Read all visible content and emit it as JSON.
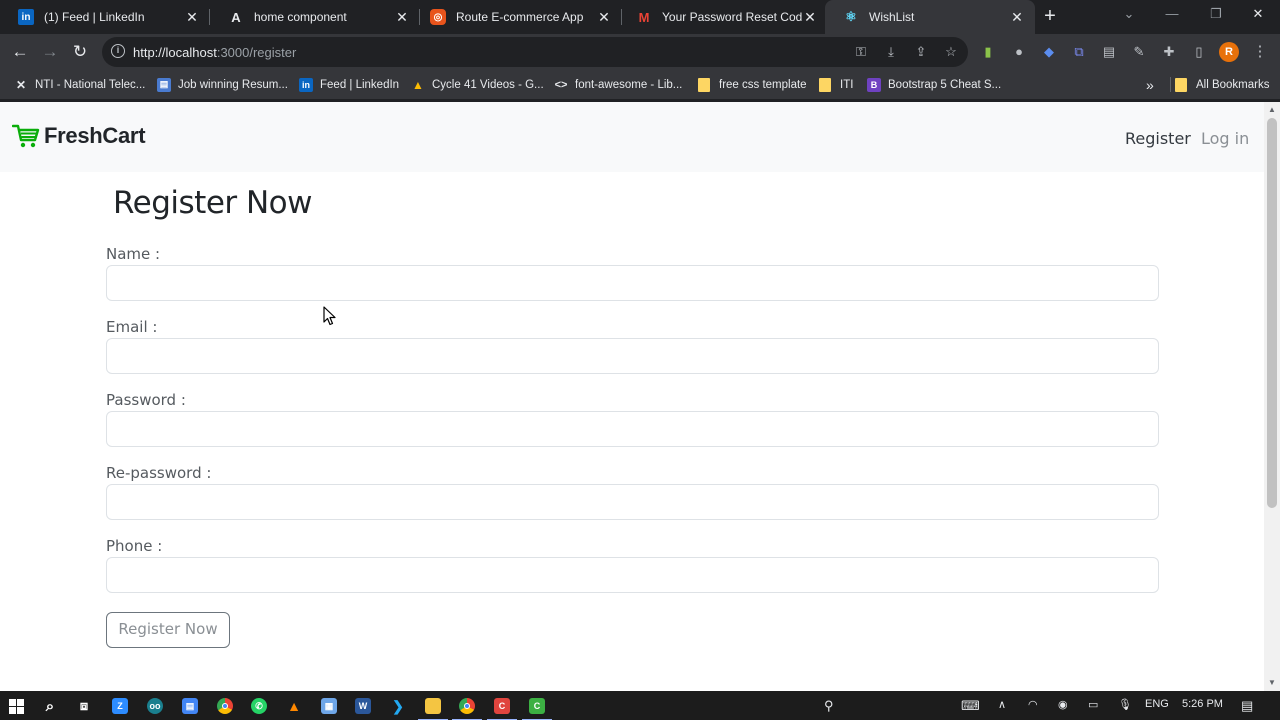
{
  "browser": {
    "tabs": [
      {
        "title": "(1) Feed | LinkedIn",
        "icon": "linkedin-icon"
      },
      {
        "title": "home component",
        "icon": "angular-icon"
      },
      {
        "title": "Route E-commerce App",
        "icon": "route-icon"
      },
      {
        "title": "Your Password Reset Code (",
        "icon": "gmail-icon"
      },
      {
        "title": "WishList",
        "icon": "react-icon",
        "active": true
      }
    ],
    "new_tab": "+",
    "window_controls": {
      "minimize": "—",
      "restore": "❐",
      "close": "✕",
      "menu": "⌄"
    },
    "url_host": "http://localhost",
    "url_rest": ":3000/register",
    "avatar_letter": "R",
    "bookmarks": [
      {
        "label": "NTI - National Telec...",
        "icon": "nti-icon"
      },
      {
        "label": "Job winning Resum...",
        "icon": "doc-icon"
      },
      {
        "label": "Feed | LinkedIn",
        "icon": "linkedin-icon"
      },
      {
        "label": "Cycle 41 Videos - G...",
        "icon": "drive-icon"
      },
      {
        "label": "font-awesome - Lib...",
        "icon": "code-icon"
      },
      {
        "label": "free css template",
        "icon": "folder-icon"
      },
      {
        "label": "ITI",
        "icon": "folder-icon"
      },
      {
        "label": "Bootstrap 5 Cheat S...",
        "icon": "bootstrap-icon"
      }
    ],
    "bookmarks_overflow": "»",
    "all_bookmarks": "All Bookmarks"
  },
  "app": {
    "brand": "FreshCart",
    "nav": {
      "register": "Register",
      "login": "Log in"
    },
    "heading": "Register Now",
    "fields": [
      {
        "label": "Name :",
        "value": ""
      },
      {
        "label": "Email :",
        "value": ""
      },
      {
        "label": "Password :",
        "value": ""
      },
      {
        "label": "Re-password :",
        "value": ""
      },
      {
        "label": "Phone :",
        "value": ""
      }
    ],
    "submit": "Register Now",
    "accent_color": "#0aad0a"
  },
  "taskbar": {
    "language": "ENG",
    "time": "5:26 PM"
  }
}
